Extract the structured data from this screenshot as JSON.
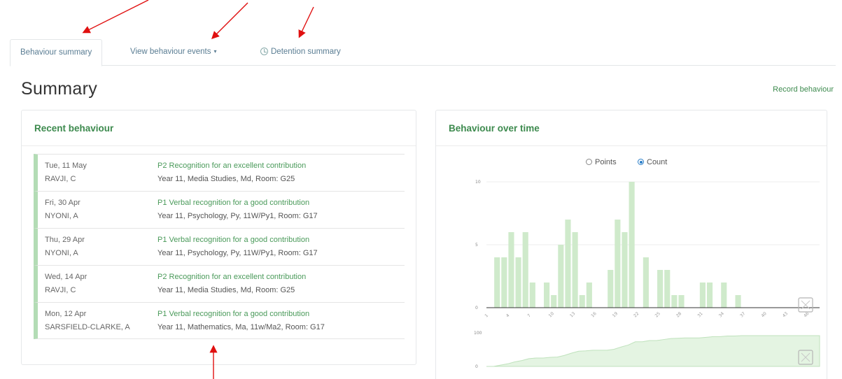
{
  "tabs": [
    {
      "label": "Behaviour summary",
      "active": true
    },
    {
      "label": "View behaviour events",
      "caret": "▾"
    },
    {
      "label": "Detention summary",
      "icon": "clock-icon"
    }
  ],
  "page_title": "Summary",
  "record_link": "Record behaviour",
  "recent": {
    "title": "Recent behaviour",
    "rows": [
      {
        "date": "Tue, 11 May",
        "student": "RAVJI, C",
        "event": "P2 Recognition for an excellent contribution",
        "detail": "Year 11, Media Studies, Md, Room: G25"
      },
      {
        "date": "Fri, 30 Apr",
        "student": "NYONI, A",
        "event": "P1 Verbal recognition for a good contribution",
        "detail": "Year 11, Psychology, Py, 11W/Py1, Room: G17"
      },
      {
        "date": "Thu, 29 Apr",
        "student": "NYONI, A",
        "event": "P1 Verbal recognition for a good contribution",
        "detail": "Year 11, Psychology, Py, 11W/Py1, Room: G17"
      },
      {
        "date": "Wed, 14 Apr",
        "student": "RAVJI, C",
        "event": "P2 Recognition for an excellent contribution",
        "detail": "Year 11, Media Studies, Md, Room: G25"
      },
      {
        "date": "Mon, 12 Apr",
        "student": "SARSFIELD-CLARKE, A",
        "event": "P1 Verbal recognition for a good contribution",
        "detail": "Year 11, Mathematics, Ma, 11w/Ma2, Room: G17"
      }
    ]
  },
  "chart_panel": {
    "title": "Behaviour over time",
    "toggle": {
      "points_label": "Points",
      "count_label": "Count",
      "selected": "count"
    },
    "expand_icon": "expand-icon"
  },
  "chart_data": {
    "type": "bar",
    "color": "#cfeacb",
    "ylim": [
      0,
      10
    ],
    "yticks": [
      0,
      5,
      10
    ],
    "ytick_labels": [
      "0",
      "5",
      "10"
    ],
    "xtick_labels": [
      "1",
      "4",
      "7",
      "10",
      "13",
      "16",
      "19",
      "22",
      "25",
      "28",
      "31",
      "34",
      "37",
      "40",
      "43",
      "46"
    ],
    "values": [
      0,
      4,
      4,
      6,
      4,
      6,
      2,
      0,
      2,
      1,
      5,
      7,
      6,
      1,
      2,
      0,
      0,
      3,
      7,
      6,
      10,
      0,
      4,
      0,
      3,
      3,
      1,
      1,
      0,
      0,
      2,
      2,
      0,
      2,
      0,
      1,
      0,
      0,
      0,
      0,
      0,
      0,
      0,
      0,
      0,
      0,
      0
    ],
    "overview": {
      "type": "area",
      "ytick_labels": [
        "0",
        "100"
      ],
      "color": "#e4f4e2"
    }
  },
  "colors": {
    "accent": "#3d8a4e",
    "bar": "#cfeacb",
    "annotation_arrow": "#e01010"
  }
}
